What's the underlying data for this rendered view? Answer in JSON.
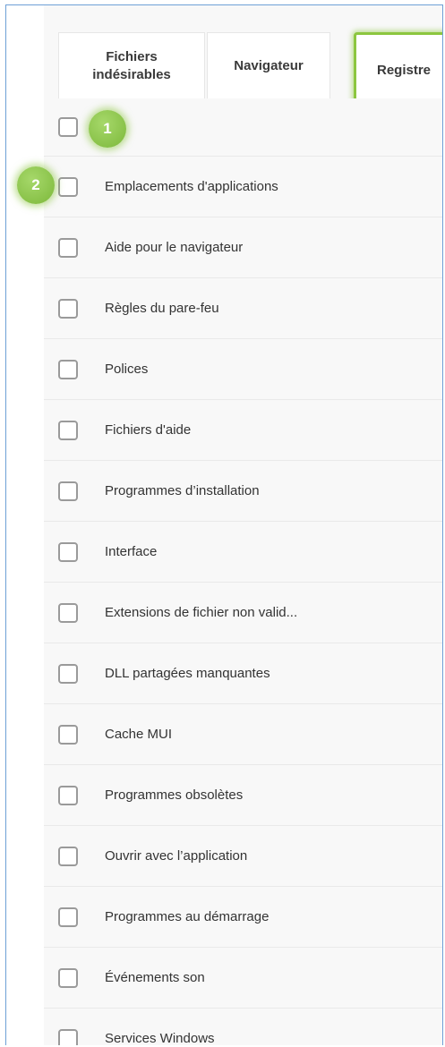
{
  "tabs": [
    {
      "label": "Fichiers\nindésirables"
    },
    {
      "label": "Navigateur"
    },
    {
      "label": "Registre"
    }
  ],
  "badges": [
    "1",
    "2"
  ],
  "items": [
    {
      "label": "Emplacements d'applications"
    },
    {
      "label": "Aide pour le navigateur"
    },
    {
      "label": "Règles du pare-feu"
    },
    {
      "label": "Polices"
    },
    {
      "label": "Fichiers d'aide"
    },
    {
      "label": "Programmes d’installation"
    },
    {
      "label": "Interface"
    },
    {
      "label": "Extensions de fichier non valid..."
    },
    {
      "label": "DLL partagées manquantes"
    },
    {
      "label": "Cache MUI"
    },
    {
      "label": "Programmes obsolètes"
    },
    {
      "label": "Ouvrir avec l’application"
    },
    {
      "label": "Programmes au démarrage"
    },
    {
      "label": "Événements son"
    },
    {
      "label": "Services Windows"
    }
  ],
  "colors": {
    "highlight": "#8cc63f",
    "frame_border": "#6ea0d6",
    "list_bg": "#f8f8f8"
  }
}
